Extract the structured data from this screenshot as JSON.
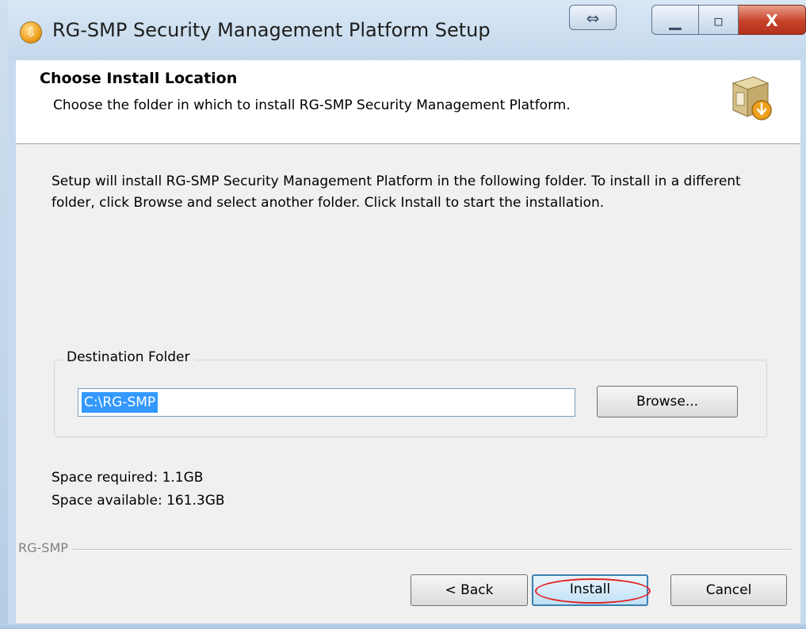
{
  "window": {
    "title": "RG-SMP Security Management Platform Setup",
    "resize_glyph": "⇔",
    "minimize_glyph": "▁",
    "maximize_glyph": "▫",
    "close_glyph": "X"
  },
  "header": {
    "title": "Choose Install Location",
    "subtitle": "Choose the folder in which to install RG-SMP Security Management Platform."
  },
  "body": {
    "description": "Setup will install RG-SMP Security Management Platform in the following folder. To install in a different folder, click Browse and select another folder. Click Install to start the installation."
  },
  "destination": {
    "group_label": "Destination Folder",
    "path": "C:\\RG-SMP",
    "browse_label": "Browse..."
  },
  "space": {
    "required": "Space required: 1.1GB",
    "available": "Space available: 161.3GB"
  },
  "footer": {
    "brand": "RG-SMP",
    "back_label": "< Back",
    "install_label": "Install",
    "cancel_label": "Cancel"
  },
  "colors": {
    "selection": "#3399ff",
    "highlight_ring": "#e32222",
    "default_button_border": "#3c7fb1"
  },
  "icons": {
    "app": "installer-disc-icon",
    "header": "install-box-icon"
  }
}
